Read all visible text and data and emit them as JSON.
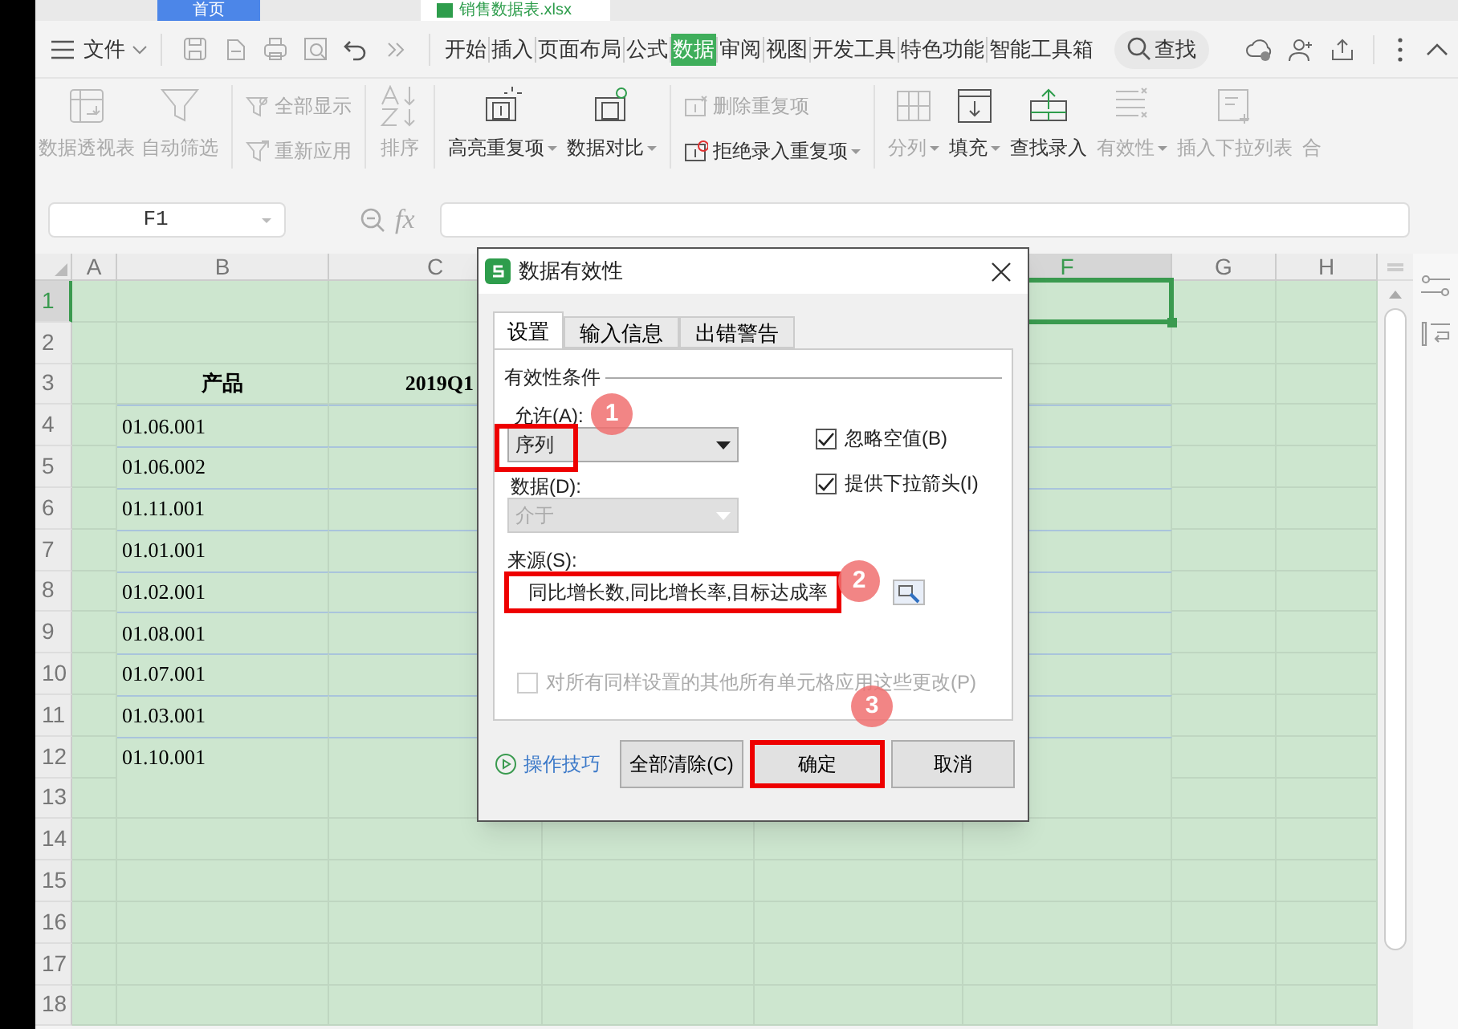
{
  "app_tabs": [
    {
      "label": "首页",
      "selected": false
    },
    {
      "label": "销售数据表.xlsx",
      "selected": true
    }
  ],
  "menu": {
    "file": "文件",
    "tabs": [
      {
        "label": "开始",
        "selected": false
      },
      {
        "label": "插入",
        "selected": false
      },
      {
        "label": "页面布局",
        "selected": false
      },
      {
        "label": "公式",
        "selected": false
      },
      {
        "label": "数据",
        "selected": true
      },
      {
        "label": "审阅",
        "selected": false
      },
      {
        "label": "视图",
        "selected": false
      },
      {
        "label": "开发工具",
        "selected": false
      },
      {
        "label": "特色功能",
        "selected": false
      },
      {
        "label": "智能工具箱",
        "selected": false
      }
    ],
    "search": "查找"
  },
  "ribbon": [
    {
      "kind": "large",
      "items": [
        {
          "label": "数据透视表",
          "disabled": true,
          "caret": false
        }
      ]
    },
    {
      "kind": "large",
      "items": [
        {
          "label": "自动筛选",
          "disabled": true,
          "caret": false
        }
      ]
    },
    {
      "kind": "stack",
      "items": [
        {
          "label": "全部显示",
          "disabled": true,
          "caret": false
        },
        {
          "label": "重新应用",
          "disabled": true,
          "caret": false
        }
      ]
    },
    {
      "kind": "sort",
      "items": [
        {
          "label": "排序",
          "disabled": true,
          "caret": false
        }
      ]
    },
    {
      "kind": "large",
      "items": [
        {
          "label": "高亮重复项",
          "disabled": false,
          "caret": true
        },
        {
          "label": "数据对比",
          "disabled": false,
          "caret": true
        }
      ]
    },
    {
      "kind": "stack",
      "items": [
        {
          "label": "删除重复项",
          "disabled": true,
          "caret": false
        },
        {
          "label": "拒绝录入重复项",
          "disabled": false,
          "caret": true
        }
      ]
    },
    {
      "kind": "large",
      "items": [
        {
          "label": "分列",
          "disabled": true,
          "caret": true
        },
        {
          "label": "填充",
          "disabled": false,
          "caret": true
        },
        {
          "label": "查找录入",
          "disabled": false,
          "caret": false
        },
        {
          "label": "有效性",
          "disabled": true,
          "caret": true
        },
        {
          "label": "插入下拉列表",
          "disabled": true,
          "caret": false
        },
        {
          "label": "合",
          "disabled": true,
          "caret": false
        }
      ]
    }
  ],
  "formula_bar": {
    "name_box": "F1",
    "fx": "fx"
  },
  "sheet": {
    "columns": [
      {
        "label": "A",
        "selected": false
      },
      {
        "label": "B",
        "selected": false
      },
      {
        "label": "C",
        "selected": false
      },
      {
        "label": "F",
        "selected": true
      },
      {
        "label": "G",
        "selected": false
      },
      {
        "label": "H",
        "selected": false
      }
    ],
    "rows": [
      {
        "number": "1",
        "selected": true,
        "kind": "blank"
      },
      {
        "number": "2",
        "selected": false,
        "kind": "blank"
      },
      {
        "number": "3",
        "selected": false,
        "kind": "header",
        "B": "产品",
        "C": "2019Q1"
      },
      {
        "number": "4",
        "selected": false,
        "kind": "data",
        "B": "01.06.001"
      },
      {
        "number": "5",
        "selected": false,
        "kind": "data",
        "B": "01.06.002"
      },
      {
        "number": "6",
        "selected": false,
        "kind": "data",
        "B": "01.11.001"
      },
      {
        "number": "7",
        "selected": false,
        "kind": "data",
        "B": "01.01.001"
      },
      {
        "number": "8",
        "selected": false,
        "kind": "data",
        "B": "01.02.001"
      },
      {
        "number": "9",
        "selected": false,
        "kind": "data",
        "B": "01.08.001"
      },
      {
        "number": "10",
        "selected": false,
        "kind": "data",
        "B": "01.07.001"
      },
      {
        "number": "11",
        "selected": false,
        "kind": "data",
        "B": "01.03.001"
      },
      {
        "number": "12",
        "selected": false,
        "kind": "data",
        "B": "01.10.001"
      },
      {
        "number": "13",
        "selected": false,
        "kind": "blank"
      },
      {
        "number": "14",
        "selected": false,
        "kind": "blank"
      },
      {
        "number": "15",
        "selected": false,
        "kind": "blank"
      },
      {
        "number": "16",
        "selected": false,
        "kind": "blank"
      },
      {
        "number": "17",
        "selected": false,
        "kind": "blank"
      },
      {
        "number": "18",
        "selected": false,
        "kind": "blank"
      }
    ]
  },
  "dialog": {
    "title": "数据有效性",
    "tabs": [
      {
        "label": "设置",
        "selected": true
      },
      {
        "label": "输入信息",
        "selected": false
      },
      {
        "label": "出错警告",
        "selected": false
      }
    ],
    "section": "有效性条件",
    "allow": {
      "label": "允许(A):",
      "value": "序列",
      "disabled": false
    },
    "data": {
      "label": "数据(D):",
      "value": "介于",
      "disabled": true
    },
    "checkboxes": [
      {
        "label": "忽略空值(B)",
        "checked": true
      },
      {
        "label": "提供下拉箭头(I)",
        "checked": true
      }
    ],
    "source": {
      "label": "来源(S):",
      "value": "同比增长数,同比增长率,目标达成率"
    },
    "apply_all": {
      "label": "对所有同样设置的其他所有单元格应用这些更改(P)",
      "checked": false,
      "disabled": true
    },
    "tips_link": "操作技巧",
    "buttons": [
      "全部清除(C)",
      "确定",
      "取消"
    ]
  },
  "annotations": [
    {
      "label": "1"
    },
    {
      "label": "2"
    },
    {
      "label": "3"
    }
  ]
}
